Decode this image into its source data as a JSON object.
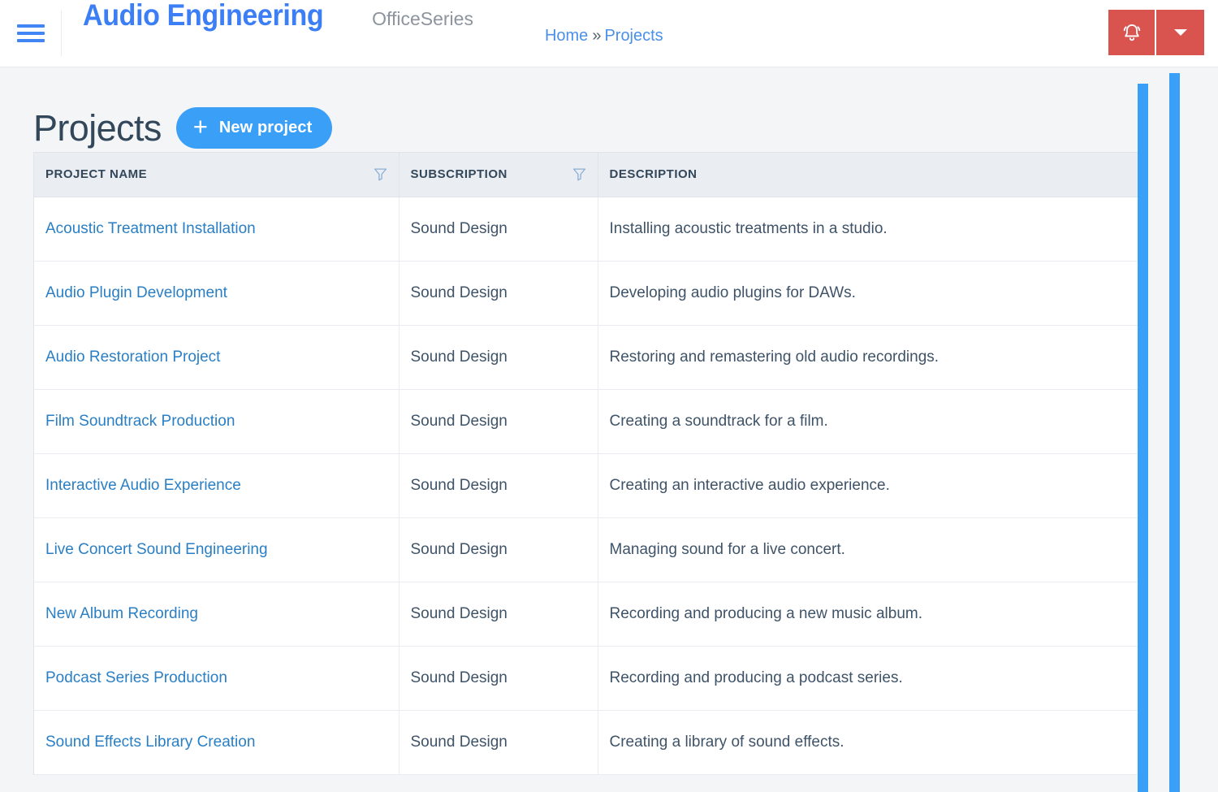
{
  "topbar": {
    "menu_icon": "hamburger-icon",
    "brand_title": "Audio Engineering",
    "brand_subtitle": "OfficeSeries",
    "breadcrumb": {
      "home": "Home",
      "separator": "»",
      "current": "Projects"
    },
    "actions": {
      "bell_icon": "bell-icon",
      "caret_icon": "chevron-down-icon"
    }
  },
  "page": {
    "title": "Projects",
    "new_button": {
      "icon": "plus-icon",
      "label": "New project"
    }
  },
  "table": {
    "columns": [
      {
        "key": "name",
        "label": "PROJECT NAME",
        "filter": true
      },
      {
        "key": "subscription",
        "label": "SUBSCRIPTION",
        "filter": true
      },
      {
        "key": "description",
        "label": "DESCRIPTION",
        "filter": false
      }
    ],
    "rows": [
      {
        "name": "Acoustic Treatment Installation",
        "subscription": "Sound Design",
        "description": "Installing acoustic treatments in a studio."
      },
      {
        "name": "Audio Plugin Development",
        "subscription": "Sound Design",
        "description": "Developing audio plugins for DAWs."
      },
      {
        "name": "Audio Restoration Project",
        "subscription": "Sound Design",
        "description": "Restoring and remastering old audio recordings."
      },
      {
        "name": "Film Soundtrack Production",
        "subscription": "Sound Design",
        "description": "Creating a soundtrack for a film."
      },
      {
        "name": "Interactive Audio Experience",
        "subscription": "Sound Design",
        "description": "Creating an interactive audio experience."
      },
      {
        "name": "Live Concert Sound Engineering",
        "subscription": "Sound Design",
        "description": "Managing sound for a live concert."
      },
      {
        "name": "New Album Recording",
        "subscription": "Sound Design",
        "description": "Recording and producing a new music album."
      },
      {
        "name": "Podcast Series Production",
        "subscription": "Sound Design",
        "description": "Recording and producing a podcast series."
      },
      {
        "name": "Sound Effects Library Creation",
        "subscription": "Sound Design",
        "description": "Creating a library of sound effects."
      }
    ]
  },
  "colors": {
    "brand_blue": "#3b7ef5",
    "link_blue": "#2a7fc4",
    "accent_blue": "#3aa0f7",
    "alert_red": "#d9534f",
    "header_bg": "#eaedf1",
    "page_bg": "#f4f5f7",
    "text_dark": "#33475b"
  }
}
